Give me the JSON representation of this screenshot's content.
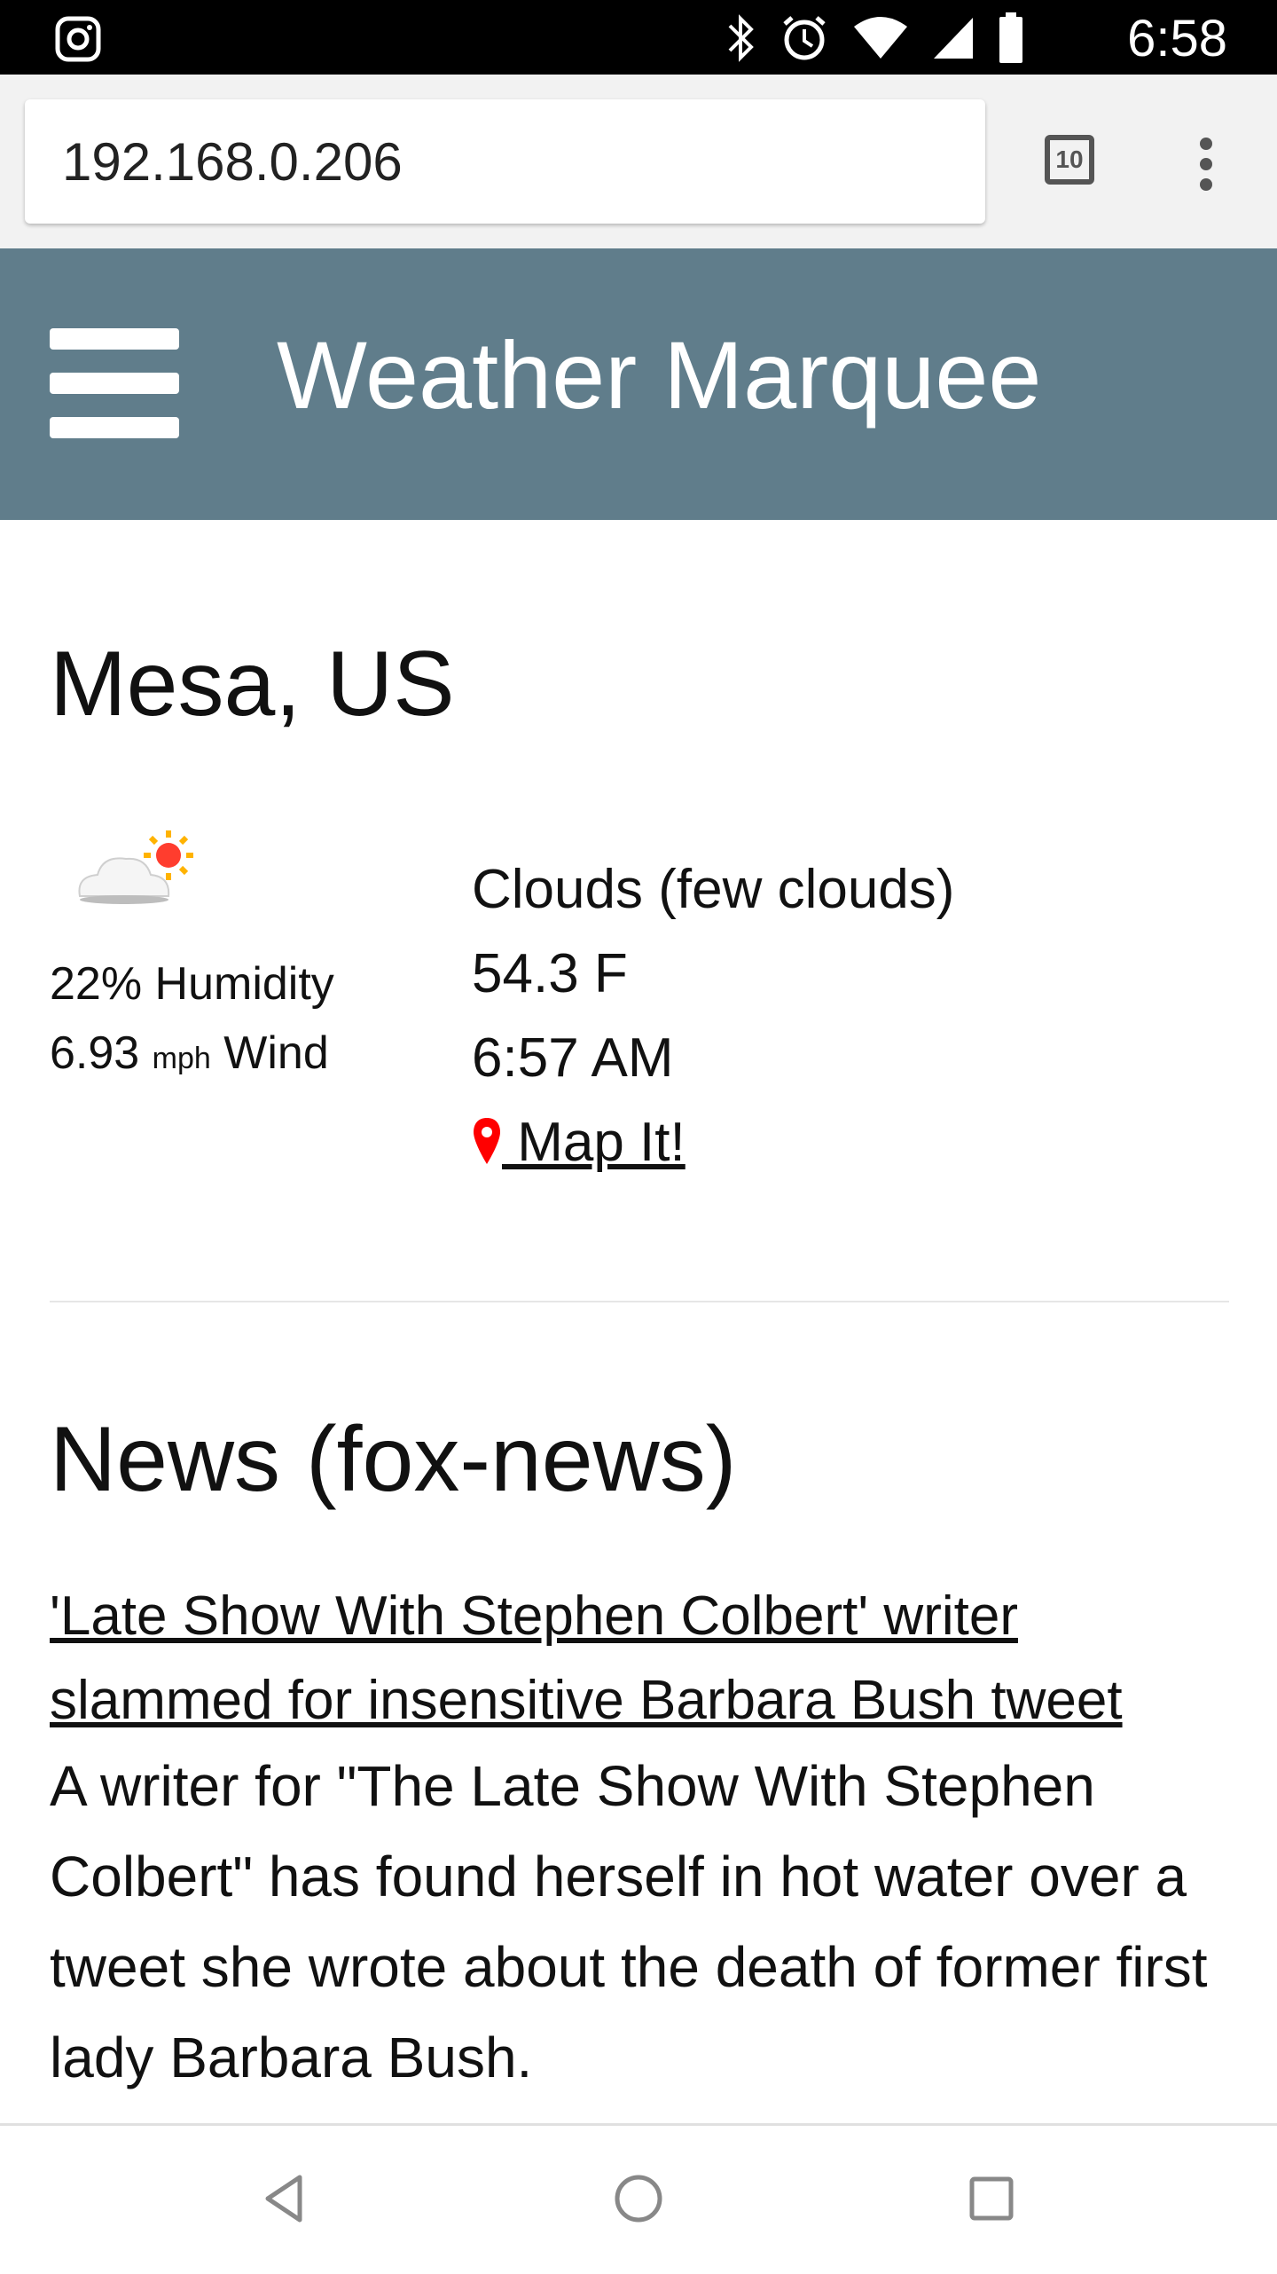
{
  "status_bar": {
    "time": "6:58",
    "icons": [
      "instagram-icon",
      "bluetooth-icon",
      "alarm-icon",
      "wifi-icon",
      "signal-icon",
      "battery-icon"
    ]
  },
  "browser": {
    "url": "192.168.0.206",
    "tab_count": "10"
  },
  "header": {
    "title": "Weather Marquee",
    "color": "#607d8b"
  },
  "weather": {
    "location": "Mesa, US",
    "humidity": "22% Humidity",
    "wind_value": "6.93",
    "wind_unit": "mph",
    "wind_label": "Wind",
    "condition": "Clouds (few clouds)",
    "temperature": "54.3 F",
    "time": "6:57 AM",
    "map_link": " Map It!"
  },
  "news": {
    "heading": "News (fox-news)",
    "headline": "'Late Show With Stephen Colbert' writer slammed for insensitive Barbara Bush tweet",
    "description": "A writer for \"The Late Show With Stephen Colbert\" has found herself in hot water over a tweet she wrote about the death of former first lady Barbara Bush."
  },
  "colors": {
    "marker_red": "#ff0000"
  }
}
